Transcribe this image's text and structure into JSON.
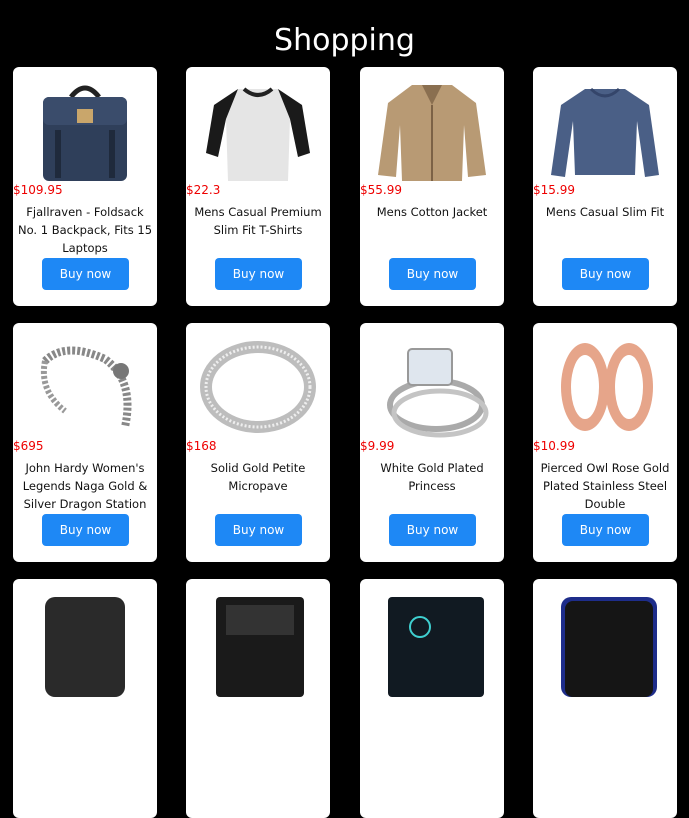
{
  "page_title": "Shopping",
  "products": [
    {
      "price": "$109.95",
      "name": "Fjallraven - Foldsack No. 1 Backpack, Fits 15 Laptops",
      "button": "Buy now",
      "icon": "backpack-icon"
    },
    {
      "price": "$22.3",
      "name": "Mens Casual Premium Slim Fit T-Shirts",
      "button": "Buy now",
      "icon": "tshirt-icon"
    },
    {
      "price": "$55.99",
      "name": "Mens Cotton Jacket",
      "button": "Buy now",
      "icon": "jacket-icon"
    },
    {
      "price": "$15.99",
      "name": "Mens Casual Slim Fit",
      "button": "Buy now",
      "icon": "sweater-icon"
    },
    {
      "price": "$695",
      "name": "John Hardy Women's Legends Naga Gold & Silver Dragon Station",
      "button": "Buy now",
      "icon": "bracelet-icon"
    },
    {
      "price": "$168",
      "name": "Solid Gold Petite Micropave",
      "button": "Buy now",
      "icon": "ring-icon"
    },
    {
      "price": "$9.99",
      "name": "White Gold Plated Princess",
      "button": "Buy now",
      "icon": "ring-set-icon"
    },
    {
      "price": "$10.99",
      "name": "Pierced Owl Rose Gold Plated Stainless Steel Double",
      "button": "Buy now",
      "icon": "plugs-icon"
    },
    {
      "icon": "hard-drive-icon"
    },
    {
      "icon": "ssd-icon"
    },
    {
      "icon": "ssd-icon"
    },
    {
      "icon": "hard-drive-icon"
    }
  ],
  "colors": {
    "background": "#000000",
    "price": "#ee0000",
    "button": "#1e88f5"
  }
}
